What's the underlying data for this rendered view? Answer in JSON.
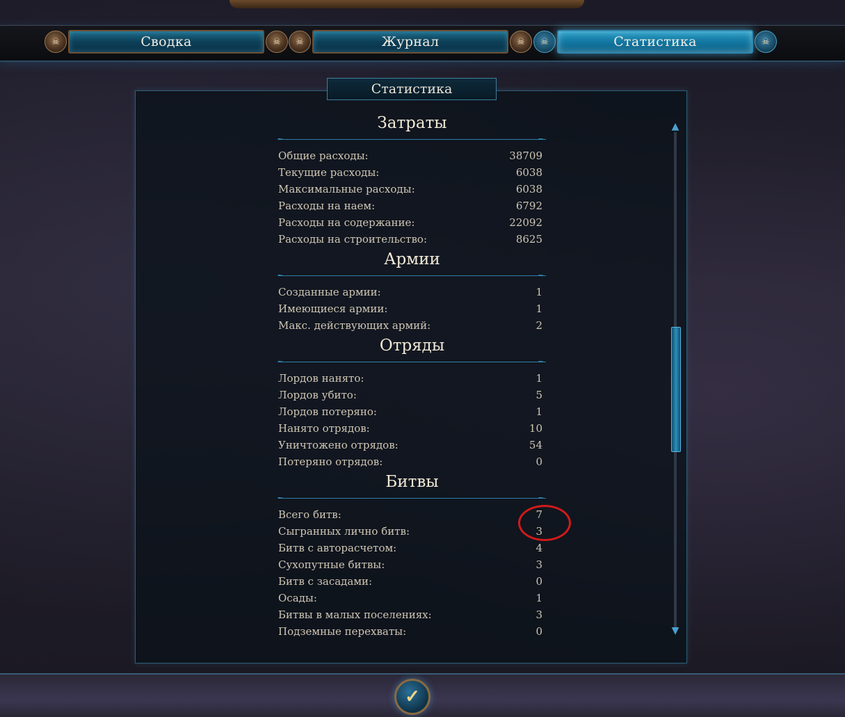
{
  "tabs": [
    {
      "label": "Сводка",
      "active": false
    },
    {
      "label": "Журнал",
      "active": false
    },
    {
      "label": "Статистика",
      "active": true
    }
  ],
  "panel_title": "Статистика",
  "sections": [
    {
      "title": "Затраты",
      "rows": [
        {
          "label": "Общие расходы:",
          "value": "38709"
        },
        {
          "label": "Текущие расходы:",
          "value": "6038"
        },
        {
          "label": "Максимальные расходы:",
          "value": "6038"
        },
        {
          "label": "Расходы на наем:",
          "value": "6792"
        },
        {
          "label": "Расходы на содержание:",
          "value": "22092"
        },
        {
          "label": "Расходы на строительство:",
          "value": "8625"
        }
      ]
    },
    {
      "title": "Армии",
      "rows": [
        {
          "label": "Созданные армии:",
          "value": "1"
        },
        {
          "label": "Имеющиеся армии:",
          "value": "1"
        },
        {
          "label": "Макс. действующих армий:",
          "value": "2"
        }
      ]
    },
    {
      "title": "Отряды",
      "rows": [
        {
          "label": "Лордов нанято:",
          "value": "1"
        },
        {
          "label": "Лордов убито:",
          "value": "5"
        },
        {
          "label": "Лордов потеряно:",
          "value": "1"
        },
        {
          "label": "Нанято отрядов:",
          "value": "10"
        },
        {
          "label": "Уничтожено отрядов:",
          "value": "54"
        },
        {
          "label": "Потеряно отрядов:",
          "value": "0"
        }
      ]
    },
    {
      "title": "Битвы",
      "rows": [
        {
          "label": "Всего битв:",
          "value": "7"
        },
        {
          "label": "Сыгранных лично битв:",
          "value": "3"
        },
        {
          "label": "Битв с авторасчетом:",
          "value": "4"
        },
        {
          "label": "Сухопутные битвы:",
          "value": "3"
        },
        {
          "label": "Битв с засадами:",
          "value": "0"
        },
        {
          "label": "Осады:",
          "value": "1"
        },
        {
          "label": "Битвы в малых поселениях:",
          "value": "3"
        },
        {
          "label": "Подземные перехваты:",
          "value": "0"
        }
      ]
    }
  ],
  "icons": {
    "tab_cap": "skull-icon",
    "scroll_up": "arrow-up-icon",
    "scroll_down": "arrow-down-icon",
    "confirm": "checkmark-icon"
  },
  "colors": {
    "accent": "#2a9cc4",
    "annotation": "#d11a1a"
  }
}
